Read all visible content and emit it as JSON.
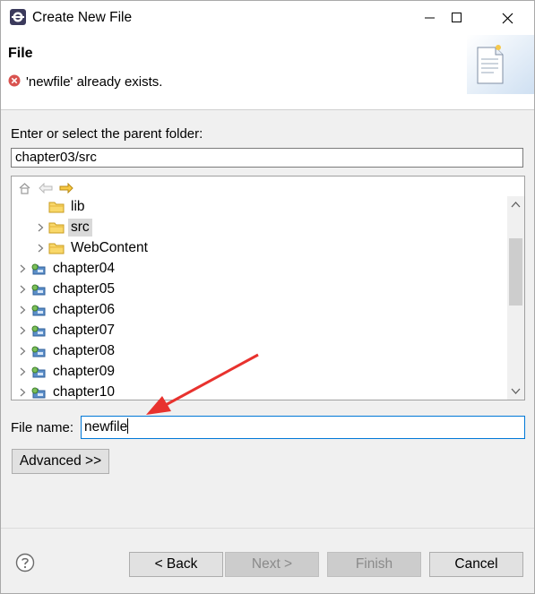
{
  "window": {
    "title": "Create New File"
  },
  "banner": {
    "title": "File",
    "message": "'newfile' already exists."
  },
  "parent_folder": {
    "label": "Enter or select the parent folder:",
    "value": "chapter03/src"
  },
  "tree": {
    "items": [
      {
        "label": "lib",
        "expandable": false,
        "icon": "folder-icon",
        "selected": false
      },
      {
        "label": "src",
        "expandable": true,
        "icon": "folder-icon",
        "selected": true
      },
      {
        "label": "WebContent",
        "expandable": true,
        "icon": "folder-icon",
        "selected": false
      },
      {
        "label": "chapter04",
        "expandable": true,
        "icon": "project-icon",
        "selected": false
      },
      {
        "label": "chapter05",
        "expandable": true,
        "icon": "project-icon",
        "selected": false
      },
      {
        "label": "chapter06",
        "expandable": true,
        "icon": "project-icon",
        "selected": false
      },
      {
        "label": "chapter07",
        "expandable": true,
        "icon": "project-icon",
        "selected": false
      },
      {
        "label": "chapter08",
        "expandable": true,
        "icon": "project-icon",
        "selected": false
      },
      {
        "label": "chapter09",
        "expandable": true,
        "icon": "project-icon",
        "selected": false
      },
      {
        "label": "chapter10",
        "expandable": true,
        "icon": "project-icon",
        "selected": false
      }
    ]
  },
  "file_name": {
    "label": "File name:",
    "value": "newfile"
  },
  "buttons": {
    "advanced": "Advanced >>",
    "back": "< Back",
    "next": "Next >",
    "finish": "Finish",
    "cancel": "Cancel"
  },
  "colors": {
    "annotation_arrow": "#e8322e",
    "focus_border": "#0078d7",
    "error_icon": "#d9534f"
  }
}
